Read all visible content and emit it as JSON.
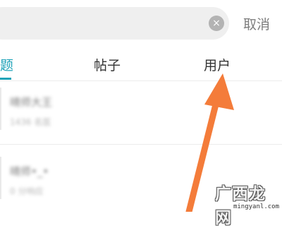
{
  "search": {
    "clear_icon": "×",
    "cancel_label": "取消"
  },
  "tabs": [
    {
      "label": "题",
      "active": true
    },
    {
      "label": "帖子",
      "active": false
    },
    {
      "label": "用户",
      "active": false
    }
  ],
  "results": [
    {
      "name": "晴师大王",
      "meta": "1436 名医"
    },
    {
      "name": "晴师•_•",
      "meta": "0 分响应"
    }
  ],
  "colors": {
    "accent": "#1fa3b8",
    "arrow": "#f47c3a"
  },
  "watermark": {
    "logo_text": "广西龙网",
    "url": "mingyanl.com"
  }
}
